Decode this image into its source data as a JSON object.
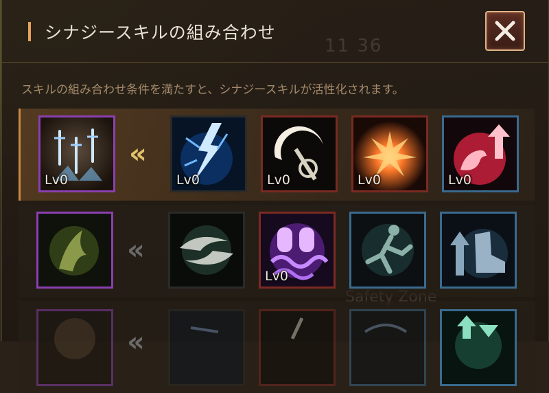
{
  "header": {
    "title": "シナジースキルの組み合わせ",
    "close_icon": "close-icon"
  },
  "description": "スキルの組み合わせ条件を満たすと、シナジースキルが活性化されます。",
  "background_hud": {
    "clock": "11 36",
    "zone": "Safety Zone"
  },
  "arrow_glyph": "«",
  "rows": [
    {
      "synergy": {
        "icon": "swords-rain-icon",
        "level": "Lv0",
        "border": "purple"
      },
      "components": [
        {
          "icon": "lightning-strike-icon",
          "level": "Lv0",
          "border": "dark"
        },
        {
          "icon": "crescent-slash-icon",
          "level": "Lv0",
          "border": "red"
        },
        {
          "icon": "ground-explosion-icon",
          "level": "Lv0",
          "border": "red"
        },
        {
          "icon": "strength-buff-icon",
          "level": "Lv0",
          "border": "blue"
        }
      ]
    },
    {
      "synergy": {
        "icon": "green-spirit-icon",
        "level": "",
        "border": "purple"
      },
      "components": [
        {
          "icon": "twin-blade-icon",
          "level": "",
          "border": "dark"
        },
        {
          "icon": "purple-ghosts-icon",
          "level": "Lv0",
          "border": "red"
        },
        {
          "icon": "dash-figure-icon",
          "level": "",
          "border": "blue"
        },
        {
          "icon": "speed-boots-icon",
          "level": "",
          "border": "blue"
        }
      ]
    },
    {
      "synergy": {
        "icon": "partial-icon",
        "level": "",
        "border": "purple"
      },
      "components": [
        {
          "icon": "partial-icon",
          "level": "",
          "border": "dark"
        },
        {
          "icon": "partial-icon",
          "level": "",
          "border": "red"
        },
        {
          "icon": "partial-icon",
          "level": "",
          "border": "blue"
        },
        {
          "icon": "hourglass-up-icon",
          "level": "",
          "border": "blue"
        }
      ]
    }
  ]
}
